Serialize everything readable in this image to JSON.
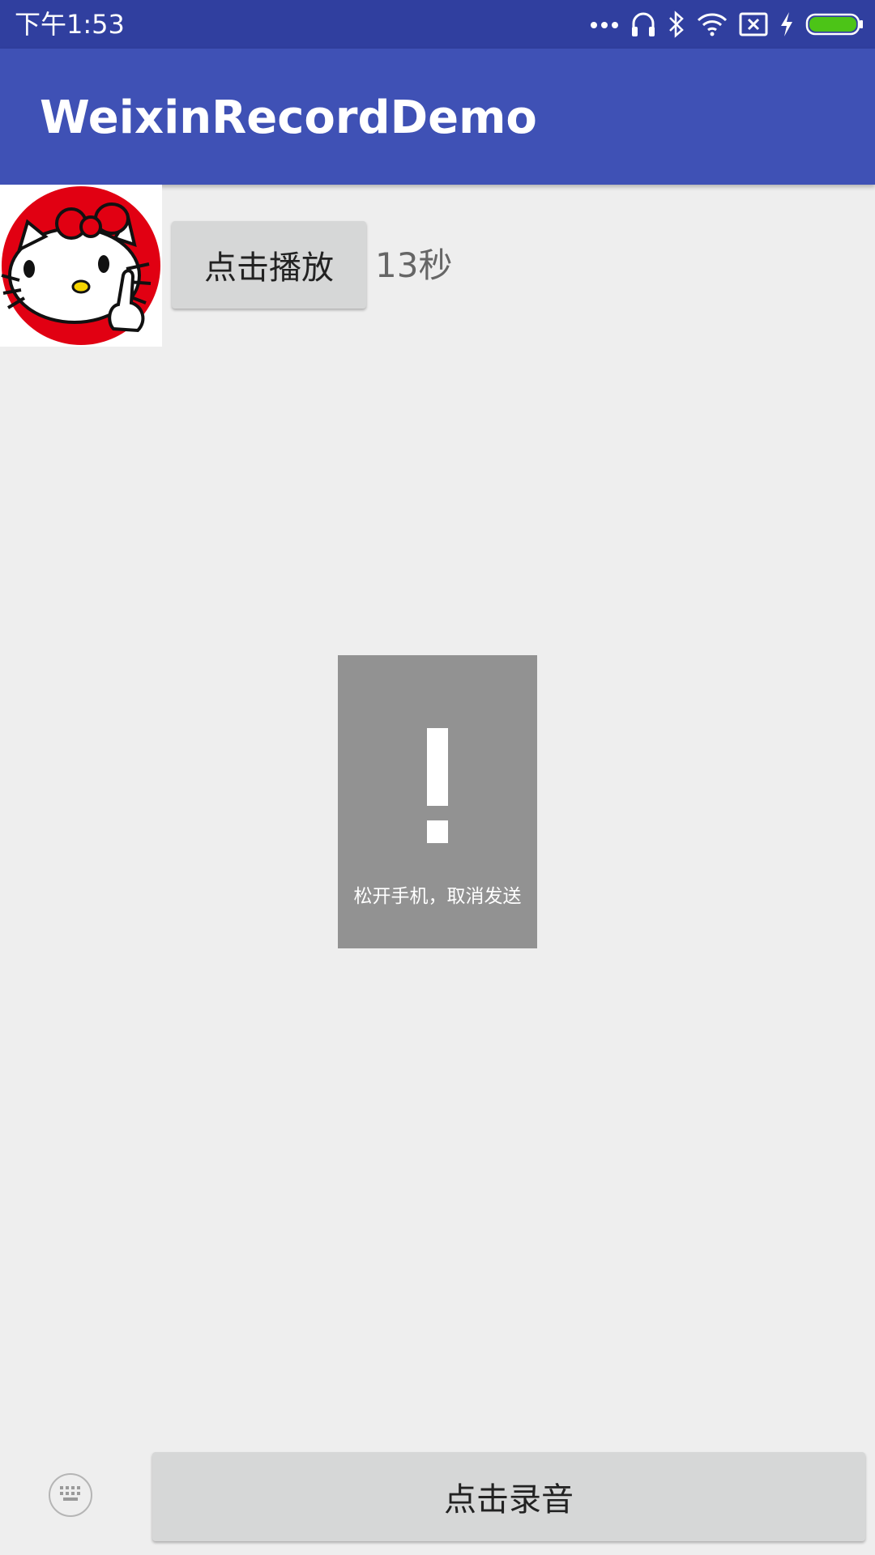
{
  "status_bar": {
    "time": "下午1:53",
    "icons": [
      "more-dots-icon",
      "headset-icon",
      "bluetooth-icon",
      "wifi-icon",
      "sim-error-icon",
      "charging-icon",
      "battery-icon"
    ],
    "background_color": "#303f9f"
  },
  "app_bar": {
    "title": "WeixinRecordDemo",
    "background_color": "#3f51b5"
  },
  "message": {
    "avatar_icon": "hello-kitty-avatar-icon",
    "play_label": "点击播放",
    "duration": "13秒"
  },
  "cancel_dialog": {
    "icon": "exclamation-icon",
    "text": "松开手机，取消发送",
    "background_color": "#929292"
  },
  "bottom_bar": {
    "keyboard_icon": "keyboard-icon",
    "record_label": "点击录音"
  }
}
